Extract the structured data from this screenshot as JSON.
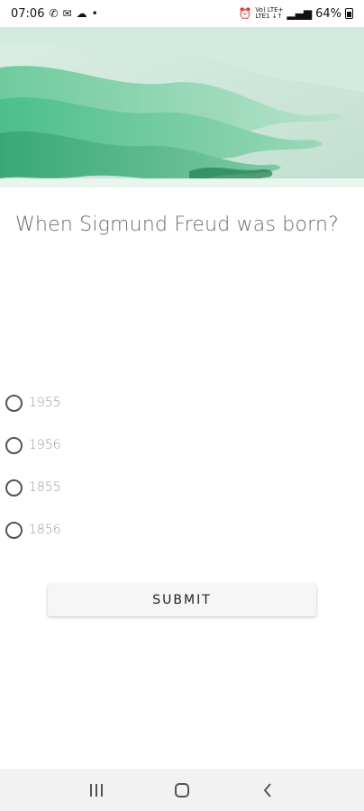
{
  "status_bar": {
    "time": "07:06",
    "network_label_top": "Vo) LTE+",
    "network_label_bottom": "LTE1 ↓↑",
    "battery": "64%"
  },
  "question": {
    "text": "When Sigmund Freud was born?"
  },
  "options": [
    {
      "label": "1955",
      "selected": false
    },
    {
      "label": "1956",
      "selected": false
    },
    {
      "label": "1855",
      "selected": false
    },
    {
      "label": "1856",
      "selected": false
    }
  ],
  "submit": {
    "label": "SUBMIT"
  },
  "colors": {
    "hero_light": "#cfe6da",
    "hero_mid": "#7fcaa5",
    "hero_dark": "#2f9d6b",
    "text_muted": "#9a9a9a",
    "question_text": "#6b6b6b"
  }
}
